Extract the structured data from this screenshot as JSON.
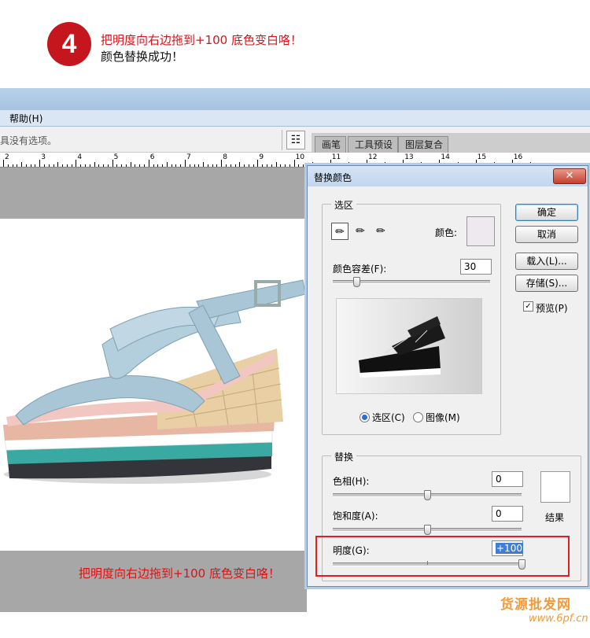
{
  "step": {
    "number": "4",
    "line1": "把明度向右边拖到+100 底色变白咯！",
    "line2": "颜色替换成功！"
  },
  "menu": {
    "help": "帮助(H)"
  },
  "options": {
    "text": "具没有选项。"
  },
  "panel_tabs": [
    "画笔",
    "工具预设",
    "图层复合"
  ],
  "ruler": {
    "labels": [
      "2",
      "3",
      "4",
      "5",
      "6",
      "7",
      "8",
      "9",
      "10",
      "11",
      "12",
      "13",
      "14",
      "15",
      "16"
    ]
  },
  "canvas": {
    "caption": "把明度向右边拖到+100 底色变白咯！"
  },
  "dialog": {
    "title": "替换颜色",
    "close": "✕",
    "selection": {
      "group_label": "选区",
      "color_label": "颜色:",
      "color_value": "#eee8ef",
      "tolerance_label": "颜色容差(F):",
      "tolerance_value": "30",
      "tolerance_level": 0.15,
      "radio_selection": "选区(C)",
      "radio_image": "图像(M)"
    },
    "buttons": {
      "ok": "确定",
      "cancel": "取消",
      "load": "载入(L)...",
      "save": "存储(S)...",
      "preview": "预览(P)"
    },
    "replace": {
      "group_label": "替换",
      "hue_label": "色相(H):",
      "hue_value": "0",
      "hue_level": 0.5,
      "saturation_label": "饱和度(A):",
      "saturation_value": "0",
      "saturation_level": 0.5,
      "lightness_label": "明度(G):",
      "lightness_value": "+100",
      "lightness_level": 1.0,
      "result_label": "结果"
    }
  },
  "watermark": {
    "main": "货源批发网",
    "sub": "www.6pf.cn"
  },
  "colors": {
    "accent_red": "#c4161c",
    "sandal_blue": "#a9c6d6",
    "sole_teal": "#3aa9a1"
  }
}
